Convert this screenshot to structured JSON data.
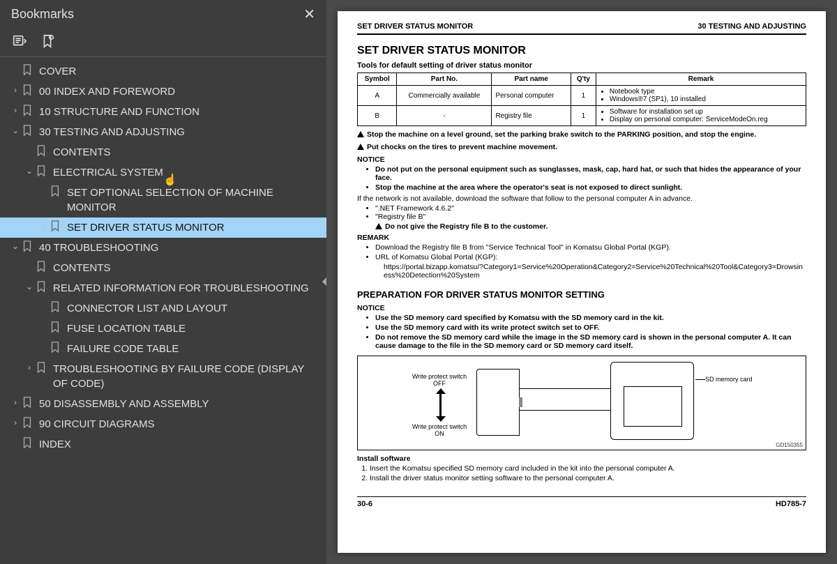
{
  "sidebar": {
    "title": "Bookmarks",
    "items": [
      {
        "label": "COVER",
        "depth": 0,
        "twisty": "",
        "selected": false
      },
      {
        "label": "00 INDEX AND FOREWORD",
        "depth": 0,
        "twisty": ">",
        "selected": false
      },
      {
        "label": "10 STRUCTURE AND FUNCTION",
        "depth": 0,
        "twisty": ">",
        "selected": false
      },
      {
        "label": "30 TESTING AND ADJUSTING",
        "depth": 0,
        "twisty": "v",
        "selected": false
      },
      {
        "label": "CONTENTS",
        "depth": 1,
        "twisty": "",
        "selected": false
      },
      {
        "label": "ELECTRICAL SYSTEM",
        "depth": 1,
        "twisty": "v",
        "selected": false
      },
      {
        "label": "SET OPTIONAL SELECTION OF MACHINE MONITOR",
        "depth": 2,
        "twisty": "",
        "selected": false
      },
      {
        "label": "SET DRIVER STATUS MONITOR",
        "depth": 2,
        "twisty": ">",
        "selected": true
      },
      {
        "label": "40 TROUBLESHOOTING",
        "depth": 0,
        "twisty": "v",
        "selected": false
      },
      {
        "label": "CONTENTS",
        "depth": 1,
        "twisty": "",
        "selected": false
      },
      {
        "label": "RELATED INFORMATION FOR TROUBLESHOOTING",
        "depth": 1,
        "twisty": "v",
        "selected": false
      },
      {
        "label": "CONNECTOR LIST AND LAYOUT",
        "depth": 2,
        "twisty": "",
        "selected": false
      },
      {
        "label": "FUSE LOCATION TABLE",
        "depth": 2,
        "twisty": "",
        "selected": false
      },
      {
        "label": "FAILURE CODE TABLE",
        "depth": 2,
        "twisty": "",
        "selected": false
      },
      {
        "label": "TROUBLESHOOTING BY FAILURE CODE (DISPLAY OF CODE)",
        "depth": 1,
        "twisty": ">",
        "selected": false
      },
      {
        "label": "50 DISASSEMBLY AND ASSEMBLY",
        "depth": 0,
        "twisty": ">",
        "selected": false
      },
      {
        "label": "90 CIRCUIT DIAGRAMS",
        "depth": 0,
        "twisty": ">",
        "selected": false
      },
      {
        "label": "INDEX",
        "depth": 0,
        "twisty": "",
        "selected": false
      }
    ]
  },
  "page": {
    "header_left": "SET DRIVER STATUS MONITOR",
    "header_right": "30 TESTING AND ADJUSTING",
    "h1": "SET DRIVER STATUS MONITOR",
    "tools_caption": "Tools for default setting of driver status monitor",
    "tools_headers": [
      "Symbol",
      "Part No.",
      "Part name",
      "Q'ty",
      "Remark"
    ],
    "tools_rows": [
      {
        "symbol": "A",
        "partno": "Commercially available",
        "partname": "Personal computer",
        "qty": "1",
        "remarks": [
          "Notebook type",
          "Windows®7 (SP1), 10 installed"
        ]
      },
      {
        "symbol": "B",
        "partno": "-",
        "partname": "Registry file",
        "qty": "1",
        "remarks": [
          "Software for installation set up",
          "Display on personal computer: ServiceModeOn.reg"
        ]
      }
    ],
    "warn1": "Stop the machine on a level ground, set the parking brake switch to the PARKING position, and stop the engine.",
    "warn2": "Put chocks on the tires to prevent machine movement.",
    "notice_label": "NOTICE",
    "notice1_items": [
      "Do not put on the personal equipment such as sunglasses, mask, cap, hard hat, or such that hides the appearance of your face.",
      "Stop the machine at the area where the operator's seat is not exposed to direct sunlight."
    ],
    "network_line": "If the network is not available, download the software that follow to the personal computer A in advance.",
    "dl_items": [
      "\".NET Framework 4.6.2\"",
      "\"Registry file B\""
    ],
    "dl_warn": "Do not give the Registry file B to the customer.",
    "remark_label": "REMARK",
    "remark_items": [
      "Download the Registry file B from \"Service Technical Tool\" in Komatsu Global Portal (KGP).",
      "URL of Komatsu Global Portal (KGP):"
    ],
    "url": "https://portal.bizapp.komatsu/?Category1=Service%20Operation&Category2=Service%20Technical%20Tool&Category3=Drowsiness%20Detection%20System",
    "h2": "PREPARATION FOR DRIVER STATUS MONITOR SETTING",
    "notice2_items": [
      "Use the SD memory card specified by Komatsu with the SD memory card in the kit.",
      "Use the SD memory card with its write protect switch set to OFF.",
      "Do not remove the SD memory card while the image in the SD memory card is shown in the personal computer A. It can cause damage to the file in the SD memory card or SD memory card itself."
    ],
    "diagram": {
      "label_off": "Write protect switch OFF",
      "label_on": "Write protect switch ON",
      "sd_label": "SD memory card",
      "figno": "GD150355"
    },
    "install_h": "Install software",
    "install_steps": [
      "Insert the Komatsu specified SD memory card included in the kit into the personal computer A.",
      "Install the driver status monitor setting software to the personal computer A."
    ],
    "footer_left": "30-6",
    "footer_right": "HD785-7"
  }
}
